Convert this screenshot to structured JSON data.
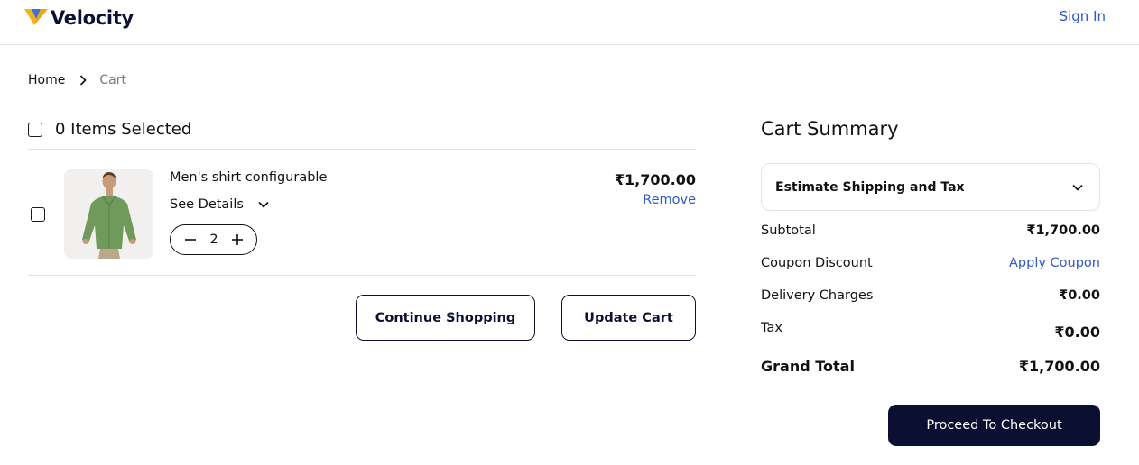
{
  "header": {
    "brand": "Velocity",
    "sign_in": "Sign In"
  },
  "breadcrumb": {
    "home": "Home",
    "current": "Cart"
  },
  "cart": {
    "selection_label": "0 Items Selected",
    "items": [
      {
        "name": "Men's shirt configurable",
        "details_label": "See Details",
        "quantity": "2",
        "price": "₹1,700.00",
        "remove_label": "Remove"
      }
    ],
    "continue_label": "Continue Shopping",
    "update_label": "Update Cart"
  },
  "summary": {
    "title": "Cart Summary",
    "estimate_label": "Estimate Shipping and Tax",
    "subtotal_label": "Subtotal",
    "subtotal_value": "₹1,700.00",
    "coupon_label": "Coupon Discount",
    "coupon_link": "Apply Coupon",
    "delivery_label": "Delivery Charges",
    "delivery_value": "₹0.00",
    "tax_label": "Tax",
    "tax_value": "₹0.00",
    "grand_label": "Grand Total",
    "grand_value": "₹1,700.00",
    "checkout_label": "Proceed To Checkout"
  },
  "colors": {
    "primary": "#0b1033",
    "link": "#2f58c9",
    "logo_gold": "#f1b419",
    "logo_blue": "#3d6fd6"
  }
}
